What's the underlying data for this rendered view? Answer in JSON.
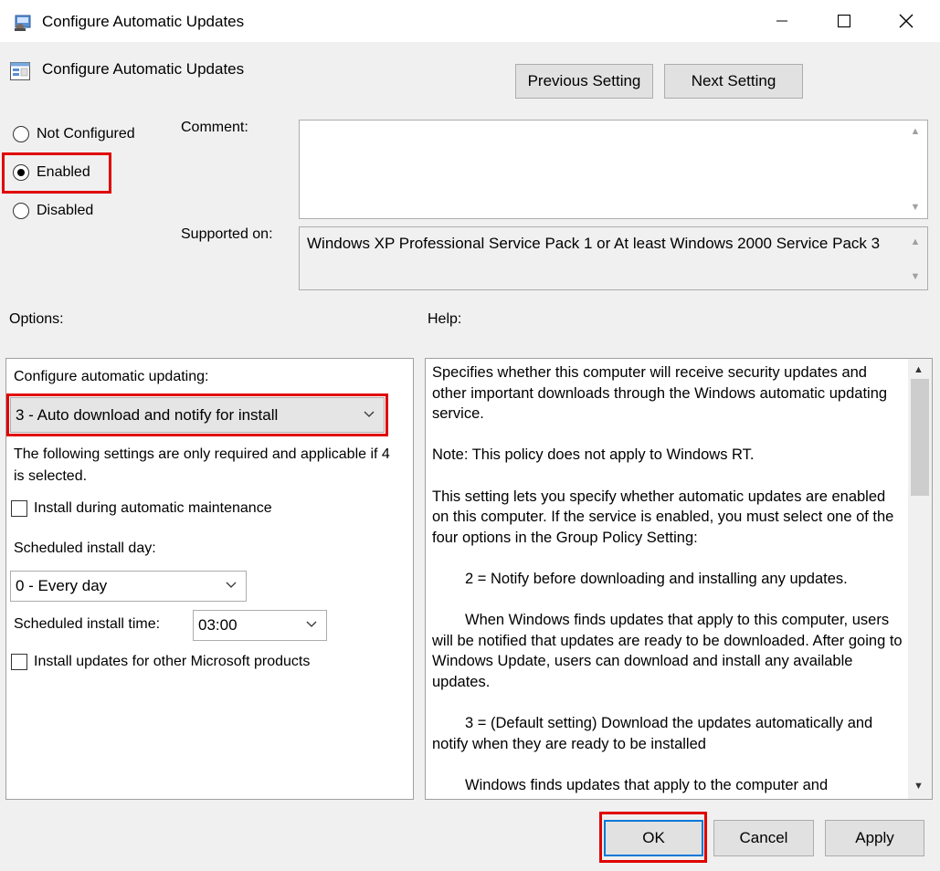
{
  "window": {
    "title": "Configure Automatic Updates",
    "controls": [
      "minimize",
      "maximize",
      "close"
    ]
  },
  "header": {
    "policy_title": "Configure Automatic Updates",
    "previous_label": "Previous Setting",
    "next_label": "Next Setting"
  },
  "state": {
    "options": [
      "Not Configured",
      "Enabled",
      "Disabled"
    ],
    "selected": "Enabled"
  },
  "comment": {
    "label": "Comment:",
    "value": ""
  },
  "supported": {
    "label": "Supported on:",
    "value": "Windows XP Professional Service Pack 1 or At least Windows 2000 Service Pack 3"
  },
  "options_label": "Options:",
  "help_label": "Help:",
  "options": {
    "configure_label": "Configure automatic updating:",
    "configure_value": "3 - Auto download and notify for install",
    "note": "The following settings are only required and applicable if 4 is selected.",
    "maintenance_label": "Install during automatic maintenance",
    "maintenance_checked": false,
    "install_day_label": "Scheduled install day:",
    "install_day_value": "0 - Every day",
    "install_time_label": "Scheduled install time:",
    "install_time_value": "03:00",
    "other_products_label": "Install updates for other Microsoft products",
    "other_products_checked": false
  },
  "help": {
    "paragraphs": [
      "Specifies whether this computer will receive security updates and other important downloads through the Windows automatic updating service.",
      "Note: This policy does not apply to Windows RT.",
      "This setting lets you specify whether automatic updates are enabled on this computer. If the service is enabled, you must select one of the four options in the Group Policy Setting:",
      "2 = Notify before downloading and installing any updates.",
      "When Windows finds updates that apply to this computer, users will be notified that updates are ready to be downloaded. After going to Windows Update, users can download and install any available updates.",
      "3 = (Default setting) Download the updates automatically and notify when they are ready to be installed",
      "Windows finds updates that apply to the computer and"
    ]
  },
  "footer": {
    "ok_label": "OK",
    "cancel_label": "Cancel",
    "apply_label": "Apply"
  },
  "colors": {
    "highlight": "#e00000",
    "focus": "#0078d7",
    "background": "#f0f0f0"
  },
  "icons": [
    "policy-app-icon",
    "policy-setting-icon",
    "minimize-icon",
    "maximize-icon",
    "close-icon",
    "chevron-down-icon",
    "scroll-up-icon",
    "scroll-down-icon"
  ]
}
